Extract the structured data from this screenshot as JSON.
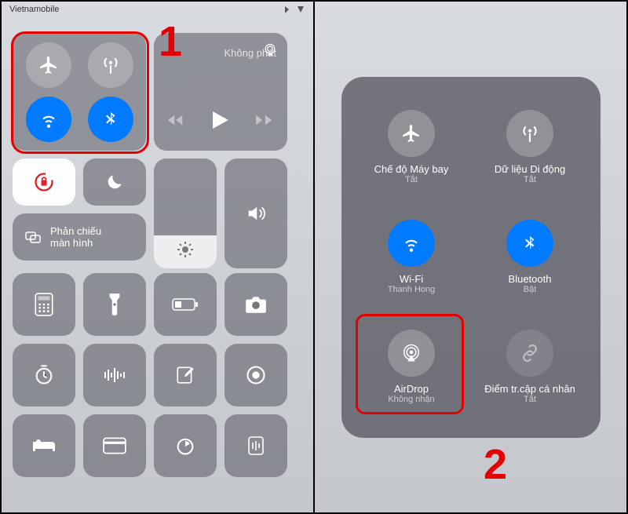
{
  "annotation": {
    "step1": "1",
    "step2": "2"
  },
  "statusbar": {
    "carrier": "Vietnamobile"
  },
  "left": {
    "media_title": "Không phát",
    "mirror_label": "Phản chiếu\nmàn hình"
  },
  "panel": {
    "airplane": {
      "label": "Chế độ Máy bay",
      "status": "Tắt"
    },
    "cellular": {
      "label": "Dữ liệu Di động",
      "status": "Tắt"
    },
    "wifi": {
      "label": "Wi-Fi",
      "status": "Thanh Hong"
    },
    "bluetooth": {
      "label": "Bluetooth",
      "status": "Bật"
    },
    "airdrop": {
      "label": "AirDrop",
      "status": "Không nhận"
    },
    "hotspot": {
      "label": "Điểm tr.cập cá nhân",
      "status": "Tắt"
    }
  }
}
